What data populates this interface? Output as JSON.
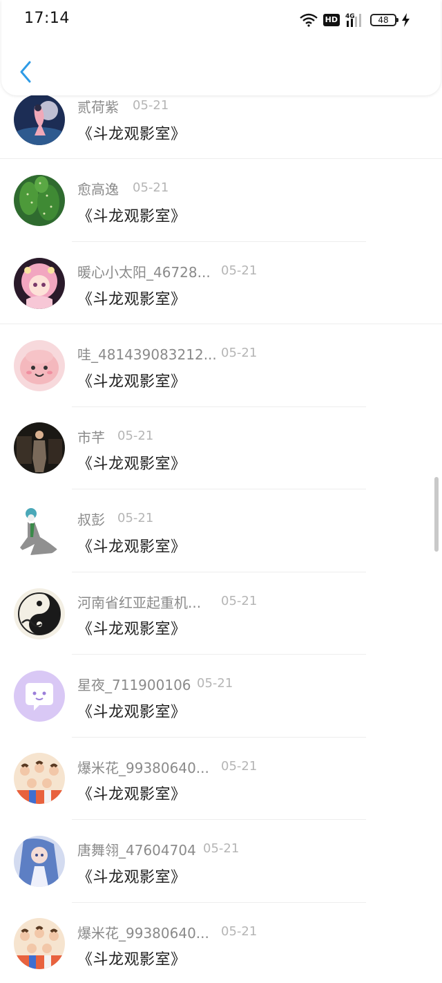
{
  "status_bar": {
    "time": "17:14",
    "network": "4G",
    "hd": "HD",
    "battery": "48"
  },
  "header": {
    "back_icon": "chevron-left-icon",
    "accent_color": "#2e9be6"
  },
  "items": [
    {
      "username": "贰荷紫",
      "date": "05-21",
      "title": "《斗龙观影室》",
      "avatar_icon": "avatar-fantasy-girl"
    },
    {
      "username": "愈高逸",
      "date": "05-21",
      "title": "《斗龙观影室》",
      "avatar_icon": "avatar-cactus"
    },
    {
      "username": "暖心小太阳_46728...",
      "date": "05-21",
      "title": "《斗龙观影室》",
      "avatar_icon": "avatar-anime-pink"
    },
    {
      "username": "哇_481439083212...",
      "date": "05-21",
      "title": "《斗龙观影室》",
      "avatar_icon": "avatar-pink-blob"
    },
    {
      "username": "市芊",
      "date": "05-21",
      "title": "《斗龙观影室》",
      "avatar_icon": "avatar-man-suit"
    },
    {
      "username": "叔彭",
      "date": "05-21",
      "title": "《斗龙观影室》",
      "avatar_icon": "avatar-gardevoir"
    },
    {
      "username": "河南省红亚起重机...",
      "date": "05-21",
      "title": "《斗龙观影室》",
      "avatar_icon": "avatar-yin-yang"
    },
    {
      "username": "星夜_711900106",
      "date": "05-21",
      "title": "《斗龙观影室》",
      "avatar_icon": "avatar-chat-bubble"
    },
    {
      "username": "爆米花_99380640...",
      "date": "05-21",
      "title": "《斗龙观影室》",
      "avatar_icon": "avatar-group-boys"
    },
    {
      "username": "唐舞翎_47604704",
      "date": "05-21",
      "title": "《斗龙观影室》",
      "avatar_icon": "avatar-blue-hair-girl"
    },
    {
      "username": "爆米花_99380640...",
      "date": "05-21",
      "title": "《斗龙观影室》",
      "avatar_icon": "avatar-group-boys"
    }
  ]
}
